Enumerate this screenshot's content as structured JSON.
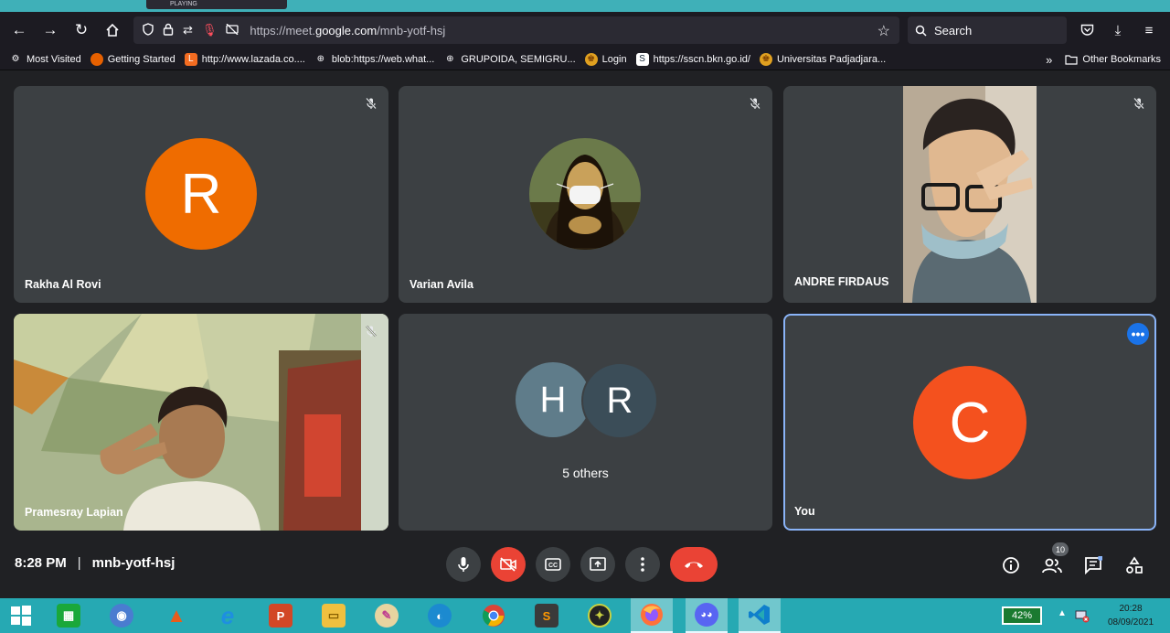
{
  "browser": {
    "playing_label": "PLAYING",
    "url_prefix": "https://meet.",
    "url_domain": "google.com",
    "url_path": "/mnb-yotf-hsj",
    "search_label": "Search"
  },
  "bookmarks": [
    {
      "label": "Most Visited",
      "color": "#1c1b22",
      "glyph": "⚙"
    },
    {
      "label": "Getting Started",
      "color": "#e66000",
      "glyph": "●"
    },
    {
      "label": "http://www.lazada.co....",
      "color": "#f36c21",
      "glyph": "L"
    },
    {
      "label": "blob:https://web.what...",
      "color": "#1c1b22",
      "glyph": "⊕"
    },
    {
      "label": "GRUPOIDA, SEMIGRU...",
      "color": "#1c1b22",
      "glyph": "⊕"
    },
    {
      "label": "Login",
      "color": "#e0a020",
      "glyph": "♚"
    },
    {
      "label": "https://sscn.bkn.go.id/",
      "color": "#ffffff",
      "glyph": "S"
    },
    {
      "label": "Universitas Padjadjara...",
      "color": "#e0a020",
      "glyph": "♚"
    }
  ],
  "other_bookmarks": "Other Bookmarks",
  "participants": [
    {
      "name": "Rakha Al Rovi",
      "avatar_letter": "R",
      "avatar_color": "#ef6c00"
    },
    {
      "name": "Varian Avila"
    },
    {
      "name": "ANDRE FIRDAUS"
    },
    {
      "name": "Pramesray Lapian"
    },
    {
      "others_label": "5 others",
      "avatar_letters": [
        "H",
        "R"
      ],
      "avatar_colors": [
        "#5f7c8a",
        "#3b4d58"
      ]
    },
    {
      "name": "You",
      "avatar_letter": "C",
      "avatar_color": "#f4511e"
    }
  ],
  "meeting": {
    "time": "8:28 PM",
    "separator": "|",
    "code": "mnb-yotf-hsj",
    "people_count": "10"
  },
  "taskbar": {
    "battery": "42%",
    "time": "20:28",
    "date": "08/09/2021"
  },
  "colors": {
    "meet_bg": "#202124",
    "tile_bg": "#3c4043",
    "end_call": "#ea4335",
    "accent_blue": "#1a73e8"
  }
}
